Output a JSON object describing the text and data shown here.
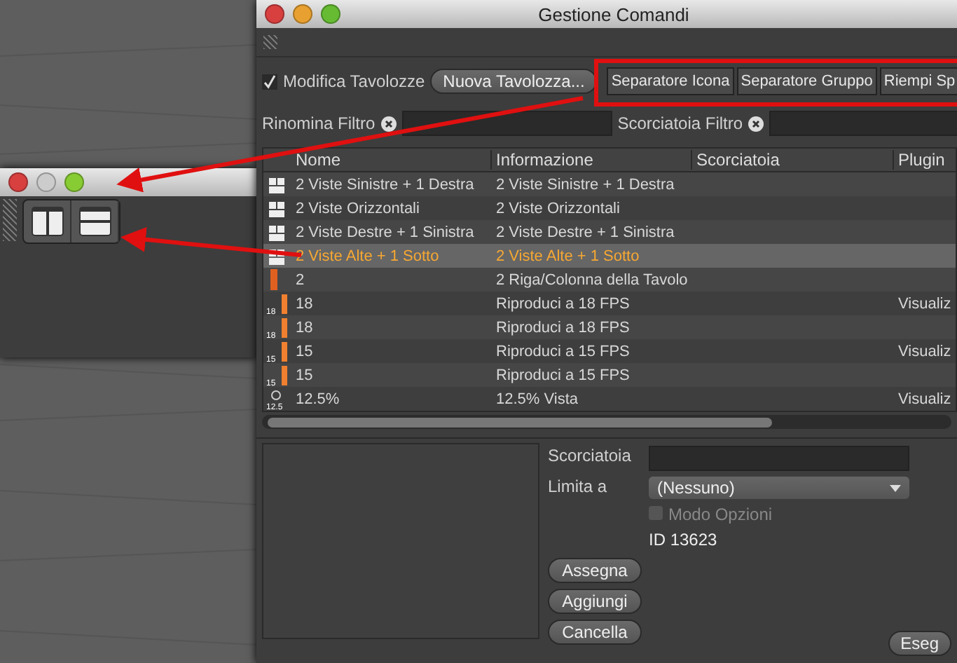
{
  "window": {
    "title": "Gestione Comandi"
  },
  "toolbar": {
    "edit_palettes": {
      "label": "Modifica Tavolozze",
      "checked": true
    },
    "new_palette": "Nuova Tavolozza...",
    "separator_buttons": [
      "Separatore Icona",
      "Separatore Gruppo",
      "Riempi Sp"
    ]
  },
  "filters": [
    {
      "label": "Rinomina Filtro"
    },
    {
      "label": "Scorciatoia Filtro"
    }
  ],
  "table": {
    "columns": [
      "Nome",
      "Informazione",
      "Scorciatoia",
      "Plugin"
    ],
    "rows": [
      {
        "kind": "layout",
        "icon_label": "",
        "name": "2 Viste Sinistre + 1 Destra",
        "info": "2 Viste Sinistre + 1 Destra",
        "plugin": "",
        "selected": false
      },
      {
        "kind": "layout",
        "icon_label": "",
        "name": "2 Viste Orizzontali",
        "info": "2 Viste Orizzontali",
        "plugin": "",
        "selected": false
      },
      {
        "kind": "layout",
        "icon_label": "",
        "name": "2 Viste Destre + 1 Sinistra",
        "info": "2 Viste Destre + 1 Sinistra",
        "plugin": "",
        "selected": false
      },
      {
        "kind": "layout",
        "icon_label": "",
        "name": "2 Viste Alte + 1 Sotto",
        "info": "2 Viste Alte + 1 Sotto",
        "plugin": "",
        "selected": true
      },
      {
        "kind": "bar",
        "icon_label": "",
        "name": "2",
        "info": "2 Riga/Colonna della Tavolo",
        "plugin": "",
        "selected": false
      },
      {
        "kind": "fps",
        "icon_label": "18",
        "name": "18",
        "info": "Riproduci a 18 FPS",
        "plugin": "Visualiz",
        "selected": false
      },
      {
        "kind": "fps",
        "icon_label": "18",
        "name": "18",
        "info": "Riproduci a 18 FPS",
        "plugin": "",
        "selected": false
      },
      {
        "kind": "fps",
        "icon_label": "15",
        "name": "15",
        "info": "Riproduci a 15 FPS",
        "plugin": "Visualiz",
        "selected": false
      },
      {
        "kind": "fps",
        "icon_label": "15",
        "name": "15",
        "info": "Riproduci a 15 FPS",
        "plugin": "",
        "selected": false
      },
      {
        "kind": "zoom",
        "icon_label": "12.5",
        "name": "12.5%",
        "info": "12.5% Vista",
        "plugin": "Visualiz",
        "selected": false
      }
    ]
  },
  "details": {
    "shortcut_label": "Scorciatoia",
    "limit_label": "Limita a",
    "limit_value": "(Nessuno)",
    "options_mode": {
      "label": "Modo Opzioni",
      "checked": false,
      "disabled": true
    },
    "id_text": "ID 13623",
    "buttons": [
      "Assegna",
      "Aggiungi",
      "Cancella"
    ],
    "execute": "Eseg"
  }
}
